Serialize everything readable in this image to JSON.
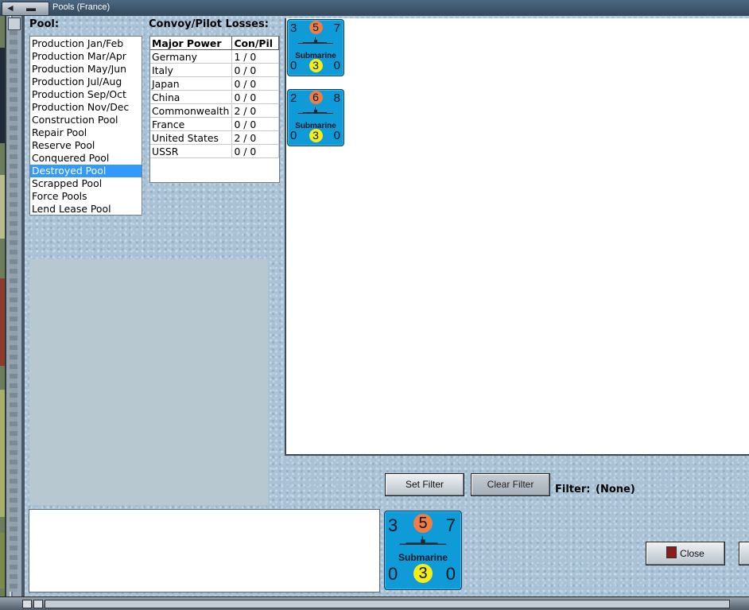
{
  "window": {
    "title": "Pools (France)"
  },
  "pool_label": "Pool:",
  "pool_items": [
    {
      "label": "Production Jan/Feb",
      "selected": false
    },
    {
      "label": "Production Mar/Apr",
      "selected": false
    },
    {
      "label": "Production May/Jun",
      "selected": false
    },
    {
      "label": "Production Jul/Aug",
      "selected": false
    },
    {
      "label": "Production Sep/Oct",
      "selected": false
    },
    {
      "label": "Production Nov/Dec",
      "selected": false
    },
    {
      "label": "Construction Pool",
      "selected": false
    },
    {
      "label": "Repair Pool",
      "selected": false
    },
    {
      "label": "Reserve Pool",
      "selected": false
    },
    {
      "label": "Conquered Pool",
      "selected": false
    },
    {
      "label": "Destroyed Pool",
      "selected": true
    },
    {
      "label": "Scrapped Pool",
      "selected": false
    },
    {
      "label": "Force Pools",
      "selected": false
    },
    {
      "label": "Lend Lease Pool",
      "selected": false
    }
  ],
  "losses": {
    "title": "Convoy/Pilot Losses:",
    "headers": [
      "Major Power",
      "Con/Pil"
    ],
    "rows": [
      [
        "Germany",
        "1 / 0"
      ],
      [
        "Italy",
        "0 / 0"
      ],
      [
        "Japan",
        "0 / 0"
      ],
      [
        "China",
        "0 / 0"
      ],
      [
        "Commonwealth",
        "2 / 0"
      ],
      [
        "France",
        "0 / 0"
      ],
      [
        "United States",
        "2 / 0"
      ],
      [
        "USSR",
        "0 / 0"
      ]
    ]
  },
  "units": [
    {
      "name": "Submarine",
      "left": "3",
      "center": "5",
      "right": "7",
      "bottom_left": "0",
      "bottom_center": "3",
      "bottom_right": "0"
    },
    {
      "name": "Submarine",
      "left": "2",
      "center": "6",
      "right": "8",
      "bottom_left": "0",
      "bottom_center": "3",
      "bottom_right": "0"
    }
  ],
  "selected_unit": {
    "name": "Submarine",
    "left": "3",
    "center": "5",
    "right": "7",
    "bottom_left": "0",
    "bottom_center": "3",
    "bottom_right": "0"
  },
  "buttons": {
    "set_filter": "Set Filter",
    "clear_filter": "Clear Filter",
    "close": "Close"
  },
  "filter": {
    "label": "Filter:",
    "value": "(None)"
  },
  "colors": {
    "background": "#a9c2d6",
    "counter_blue": "#0f9ad8",
    "attack_circle": "#ef7d45",
    "def_circle": "#f5ec1a",
    "selection": "#3399ff"
  }
}
